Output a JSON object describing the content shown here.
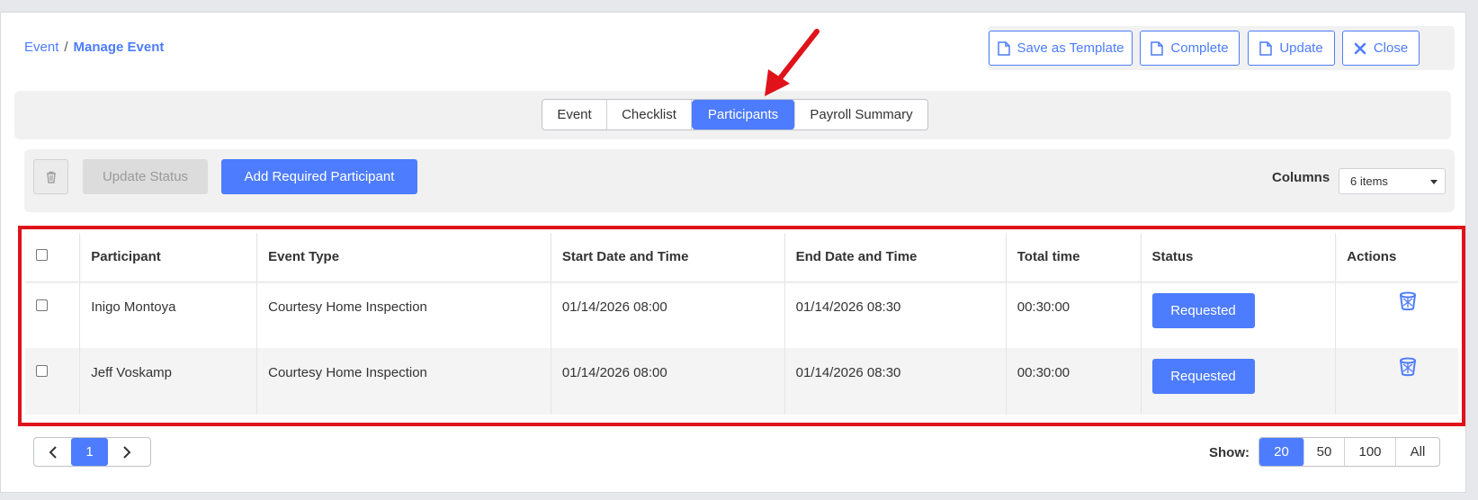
{
  "breadcrumb": {
    "parent": "Event",
    "separator": "/",
    "current": "Manage Event"
  },
  "header_actions": {
    "save_template": "Save as Template",
    "complete": "Complete",
    "update": "Update",
    "close": "Close"
  },
  "tabs": [
    "Event",
    "Checklist",
    "Participants",
    "Payroll Summary"
  ],
  "active_tab": "Participants",
  "toolbar": {
    "update_status": "Update Status",
    "add_required": "Add Required Participant",
    "columns_label": "Columns",
    "columns_value": "6 items"
  },
  "table": {
    "headers": [
      "Participant",
      "Event Type",
      "Start Date and Time",
      "End Date and Time",
      "Total time",
      "Status",
      "Actions"
    ],
    "rows": [
      {
        "participant": "Inigo Montoya",
        "event_type": "Courtesy Home Inspection",
        "start": "01/14/2026 08:00",
        "end": "01/14/2026 08:30",
        "total": "00:30:00",
        "status": "Requested"
      },
      {
        "participant": "Jeff Voskamp",
        "event_type": "Courtesy Home Inspection",
        "start": "01/14/2026 08:00",
        "end": "01/14/2026 08:30",
        "total": "00:30:00",
        "status": "Requested"
      }
    ]
  },
  "pagination": {
    "current_page": "1"
  },
  "show": {
    "label": "Show:",
    "options": [
      "20",
      "50",
      "100",
      "All"
    ],
    "selected": "20"
  },
  "colors": {
    "accent": "#4d7cfe",
    "highlight": "#e0121a",
    "panel": "#f1f1f1"
  },
  "icons": [
    "file-icon",
    "close-icon",
    "trash-icon",
    "chevron-left-icon",
    "chevron-right-icon",
    "delete-icon",
    "arrow-annotation"
  ]
}
